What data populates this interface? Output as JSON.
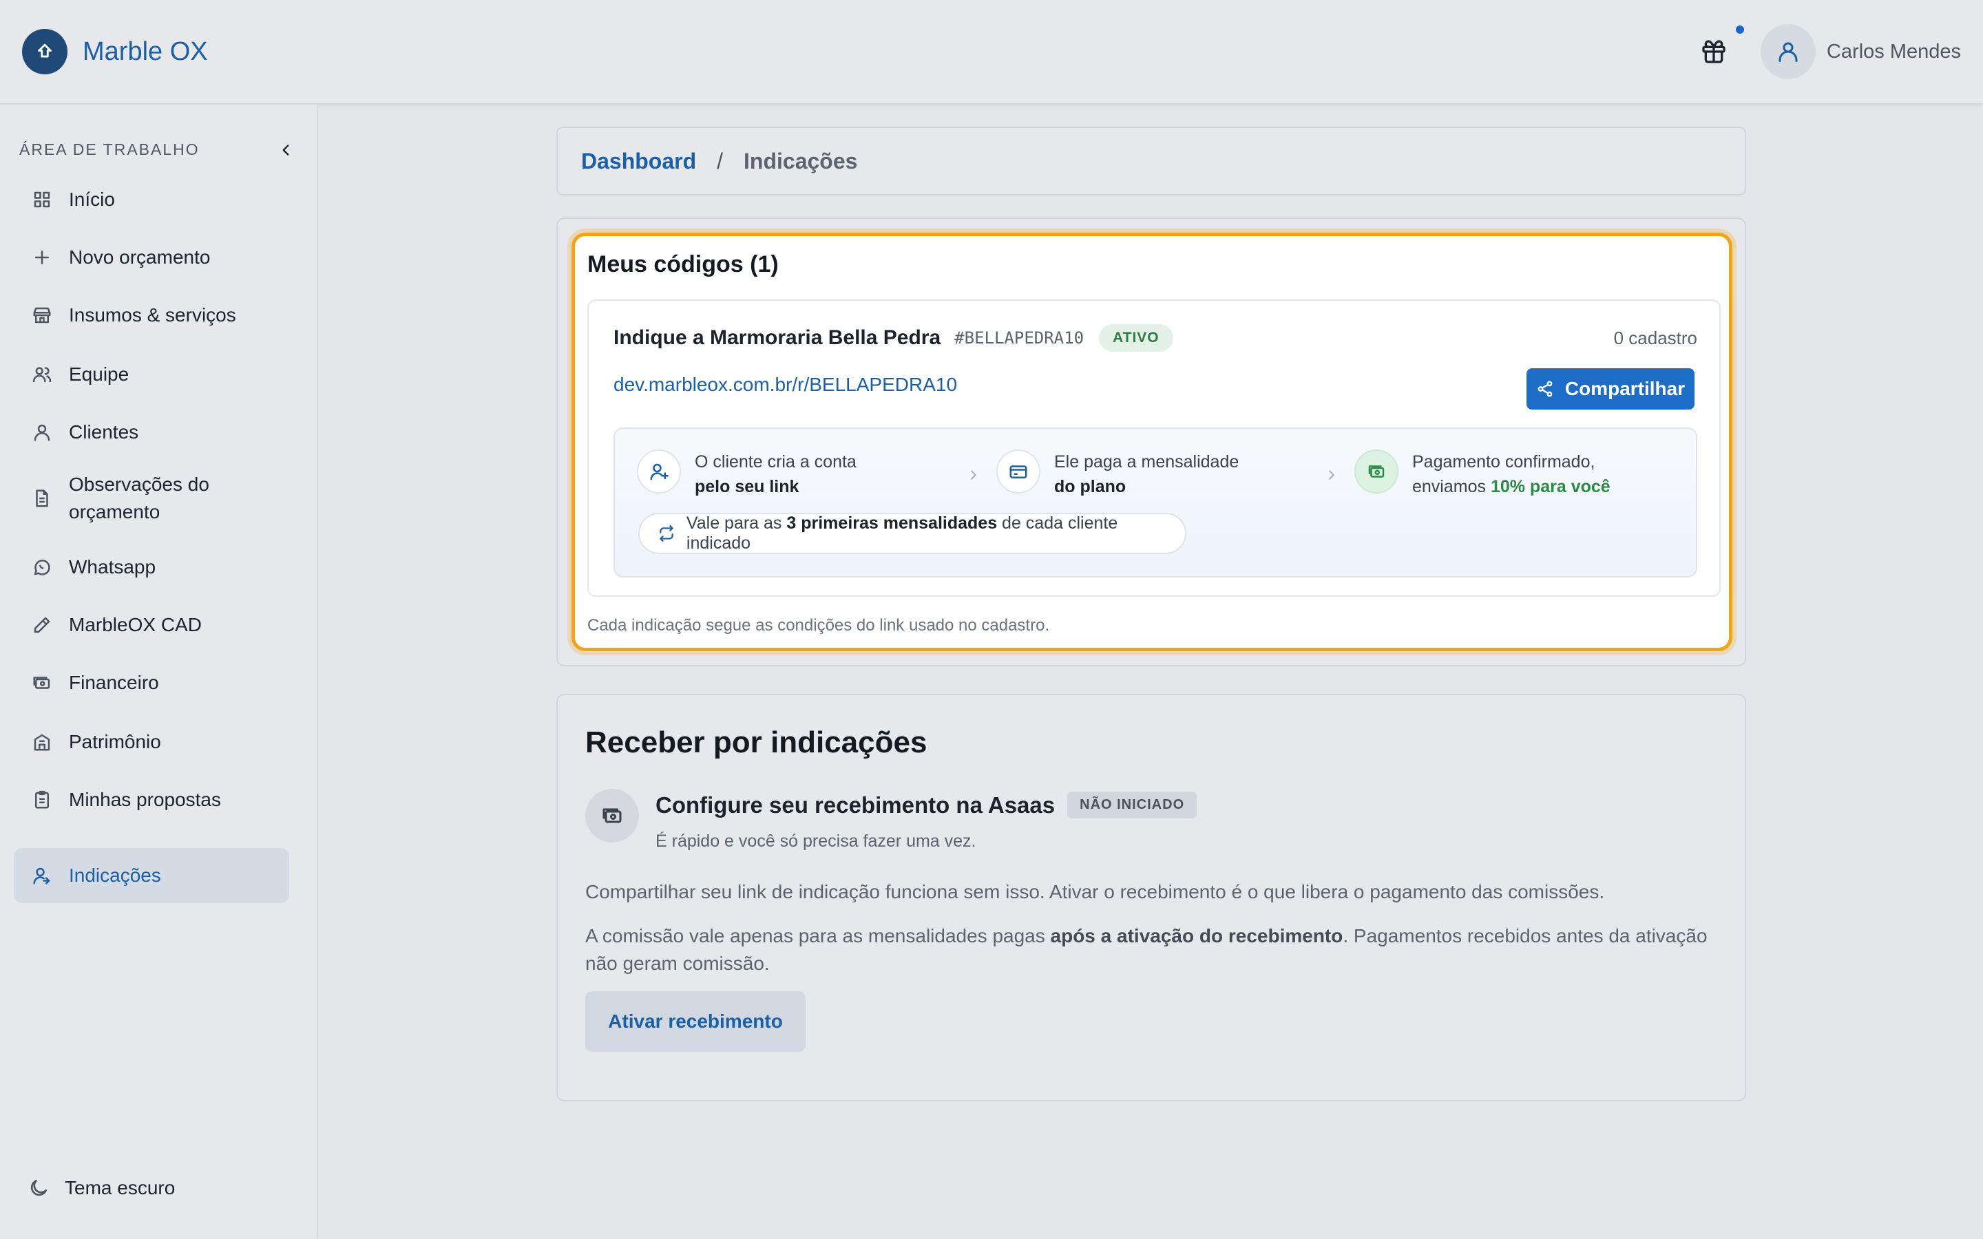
{
  "header": {
    "brand": "Marble OX",
    "user_name": "Carlos Mendes"
  },
  "sidebar": {
    "title": "ÁREA DE TRABALHO",
    "items": [
      {
        "label": "Início",
        "icon": "grid-icon"
      },
      {
        "label": "Novo orçamento",
        "icon": "plus-icon"
      },
      {
        "label": "Insumos & serviços",
        "icon": "store-icon"
      },
      {
        "label": "Equipe",
        "icon": "users-icon"
      },
      {
        "label": "Clientes",
        "icon": "user-icon"
      },
      {
        "label": "Observações do orçamento",
        "icon": "document-icon"
      },
      {
        "label": "Whatsapp",
        "icon": "whatsapp-icon"
      },
      {
        "label": "MarbleOX CAD",
        "icon": "pencil-icon"
      },
      {
        "label": "Financeiro",
        "icon": "banknote-icon"
      },
      {
        "label": "Patrimônio",
        "icon": "building-icon"
      },
      {
        "label": "Minhas propostas",
        "icon": "clipboard-icon"
      },
      {
        "label": "Indicações",
        "icon": "user-referral-icon",
        "active": true
      }
    ],
    "theme_toggle": "Tema escuro"
  },
  "breadcrumb": {
    "root": "Dashboard",
    "separator": "/",
    "current": "Indicações"
  },
  "codes": {
    "title": "Meus códigos (1)",
    "item": {
      "name": "Indique a Marmoraria Bella Pedra",
      "code": "#BELLAPEDRA10",
      "status": "ATIVO",
      "count": "0 cadastro",
      "link": "dev.marbleox.com.br/r/BELLAPEDRA10",
      "share_label": "Compartilhar"
    },
    "steps": [
      {
        "line1": "O cliente cria a conta",
        "line2": "pelo seu link"
      },
      {
        "line1": "Ele paga a mensalidade",
        "line2": "do plano"
      },
      {
        "line1": "Pagamento confirmado,",
        "line2_prefix": "enviamos ",
        "line2": "10% para você"
      }
    ],
    "pill": {
      "prefix": "Vale para as ",
      "bold": "3 primeiras mensalidades",
      "suffix": " de cada cliente indicado"
    },
    "footnote": "Cada indicação segue as condições do link usado no cadastro."
  },
  "receive": {
    "title": "Receber por indicações",
    "subtitle": "Configure seu recebimento na Asaas",
    "status": "NÃO INICIADO",
    "subtitle_desc": "É rápido e você só precisa fazer uma vez.",
    "p1": "Compartilhar seu link de indicação funciona sem isso. Ativar o recebimento é o que libera o pagamento das comissões.",
    "p2_prefix": "A comissão vale apenas para as mensalidades pagas ",
    "p2_bold": "após a ativação do recebimento",
    "p2_suffix": ". Pagamentos recebidos antes da ativação não geram comissão.",
    "button": "Ativar recebimento"
  },
  "colors": {
    "accent": "#1b5fa6",
    "highlight_border": "#f2a417",
    "status_green": "#2f7a45"
  }
}
